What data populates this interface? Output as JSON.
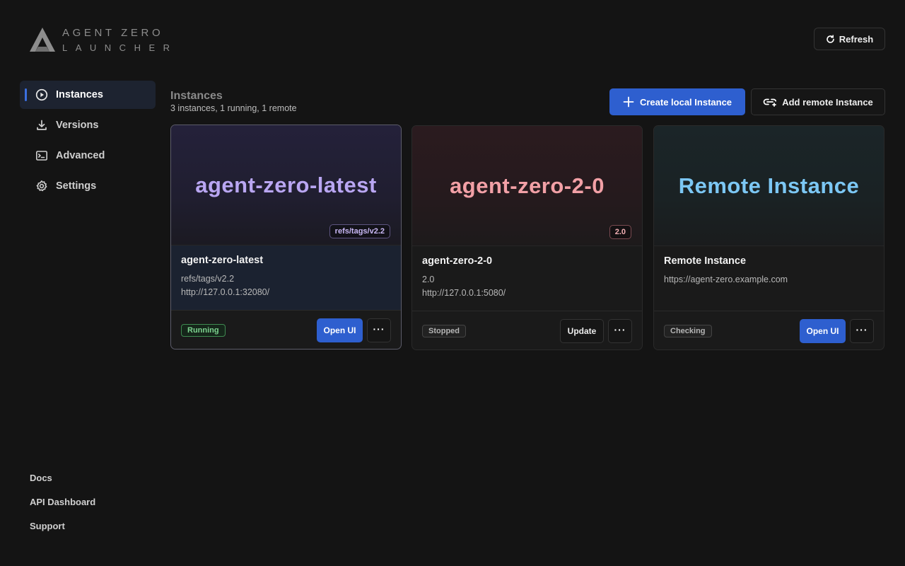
{
  "brand": {
    "line1": "AGENT ZERO",
    "line2": "LAUNCHER"
  },
  "header": {
    "refresh_label": "Refresh"
  },
  "sidebar": {
    "items": [
      {
        "label": "Instances",
        "icon": "play-circle-icon",
        "active": true
      },
      {
        "label": "Versions",
        "icon": "download-icon"
      },
      {
        "label": "Advanced",
        "icon": "terminal-icon"
      },
      {
        "label": "Settings",
        "icon": "gear-icon"
      }
    ],
    "footer": [
      "Docs",
      "API Dashboard",
      "Support"
    ]
  },
  "main": {
    "title": "Instances",
    "subtitle": "3 instances, 1 running, 1 remote",
    "create_label": "Create local Instance",
    "add_remote_label": "Add remote Instance"
  },
  "instances": [
    {
      "hero_title": "agent-zero-latest",
      "tag": "refs/tags/v2.2",
      "name": "agent-zero-latest",
      "version": "refs/tags/v2.2",
      "url": "http://127.0.0.1:32080/",
      "status": "Running",
      "primary_action": "Open UI",
      "more": "···",
      "accent": "#b9a6f2"
    },
    {
      "hero_title": "agent-zero-2-0",
      "tag": "2.0",
      "name": "agent-zero-2-0",
      "version": "2.0",
      "url": "http://127.0.0.1:5080/",
      "status": "Stopped",
      "primary_action": "Update",
      "more": "···",
      "accent": "#f2a0a6"
    },
    {
      "hero_title": "Remote Instance",
      "name": "Remote Instance",
      "url": "https://agent-zero.example.com",
      "status": "Checking",
      "primary_action": "Open UI",
      "more": "···",
      "accent": "#7cc7f4"
    }
  ]
}
